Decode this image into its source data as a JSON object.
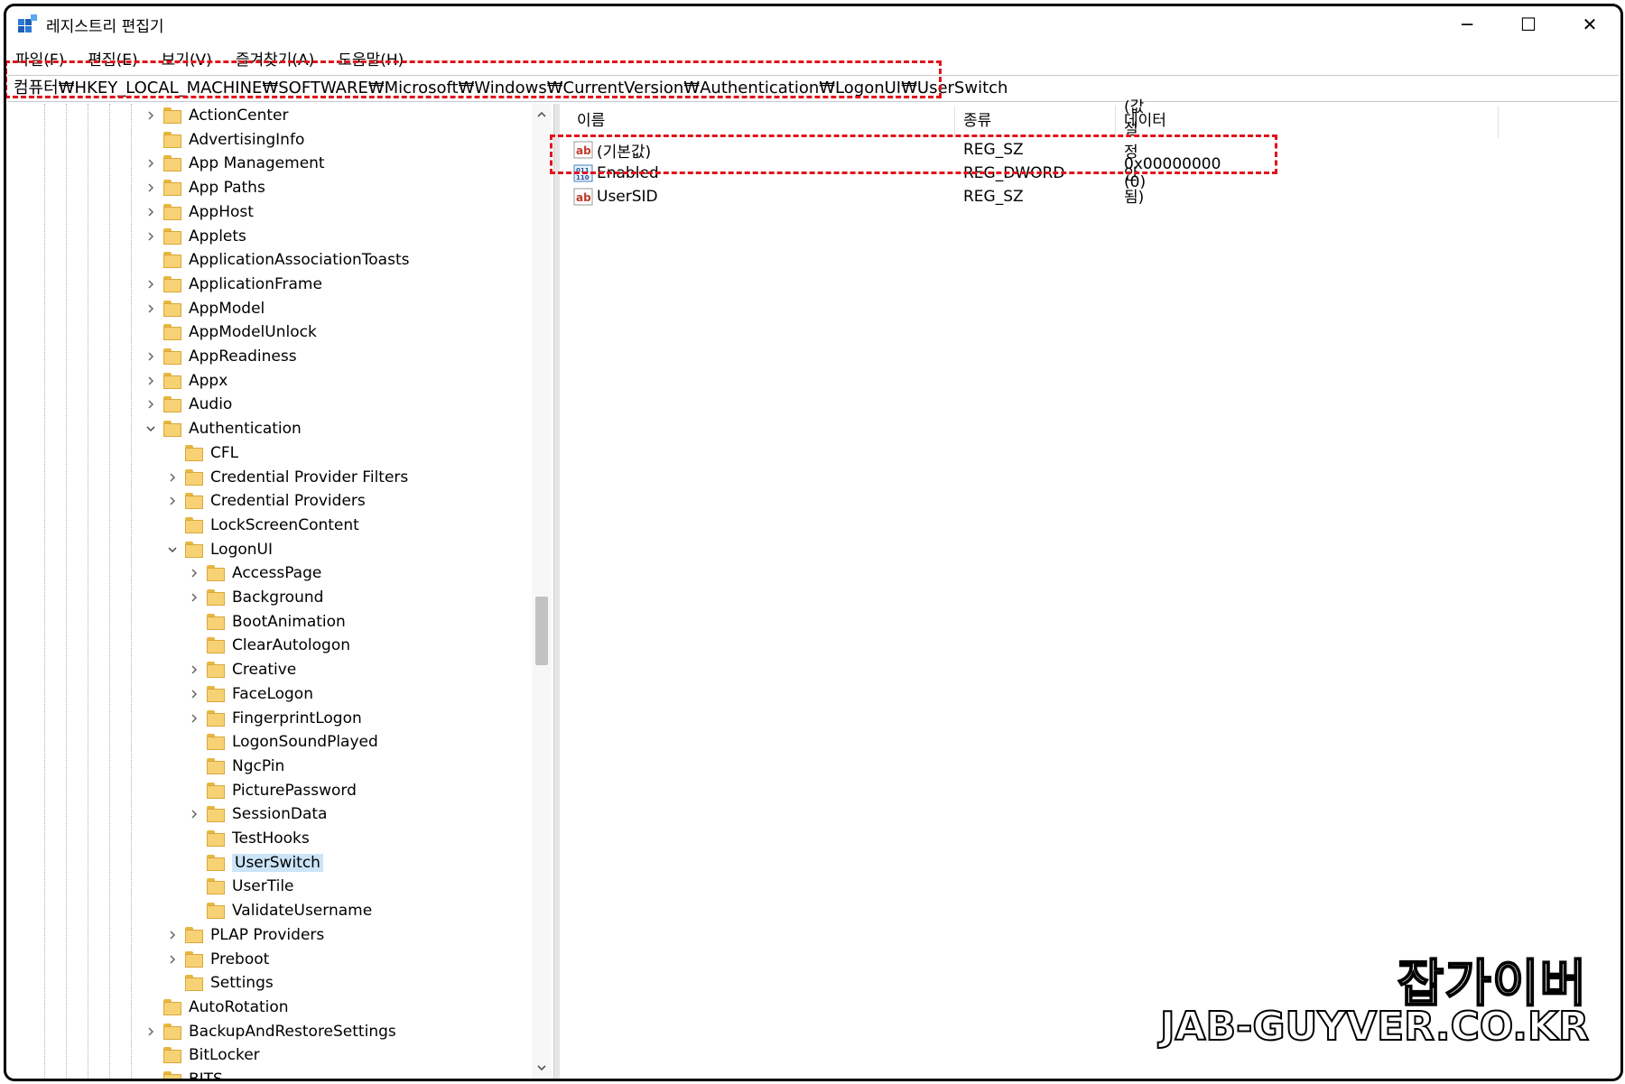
{
  "window": {
    "title": "레지스트리 편집기",
    "controls": [
      "─",
      "☐",
      "✕"
    ]
  },
  "menu": [
    "파일(F)",
    "편집(E)",
    "보기(V)",
    "즐겨찾기(A)",
    "도움말(H)"
  ],
  "address": "컴퓨터₩HKEY_LOCAL_MACHINE₩SOFTWARE₩Microsoft₩Windows₩CurrentVersion₩Authentication₩LogonUI₩UserSwitch",
  "tree": [
    {
      "label": "ActionCenter",
      "level": 0,
      "exp": "collapsed"
    },
    {
      "label": "AdvertisingInfo",
      "level": 0,
      "exp": "none"
    },
    {
      "label": "App Management",
      "level": 0,
      "exp": "collapsed"
    },
    {
      "label": "App Paths",
      "level": 0,
      "exp": "collapsed"
    },
    {
      "label": "AppHost",
      "level": 0,
      "exp": "collapsed"
    },
    {
      "label": "Applets",
      "level": 0,
      "exp": "collapsed"
    },
    {
      "label": "ApplicationAssociationToasts",
      "level": 0,
      "exp": "none"
    },
    {
      "label": "ApplicationFrame",
      "level": 0,
      "exp": "collapsed"
    },
    {
      "label": "AppModel",
      "level": 0,
      "exp": "collapsed"
    },
    {
      "label": "AppModelUnlock",
      "level": 0,
      "exp": "none"
    },
    {
      "label": "AppReadiness",
      "level": 0,
      "exp": "collapsed"
    },
    {
      "label": "Appx",
      "level": 0,
      "exp": "collapsed"
    },
    {
      "label": "Audio",
      "level": 0,
      "exp": "collapsed"
    },
    {
      "label": "Authentication",
      "level": 0,
      "exp": "expanded"
    },
    {
      "label": "CFL",
      "level": 1,
      "exp": "none"
    },
    {
      "label": "Credential Provider Filters",
      "level": 1,
      "exp": "collapsed"
    },
    {
      "label": "Credential Providers",
      "level": 1,
      "exp": "collapsed"
    },
    {
      "label": "LockScreenContent",
      "level": 1,
      "exp": "none"
    },
    {
      "label": "LogonUI",
      "level": 1,
      "exp": "expanded"
    },
    {
      "label": "AccessPage",
      "level": 2,
      "exp": "collapsed"
    },
    {
      "label": "Background",
      "level": 2,
      "exp": "collapsed"
    },
    {
      "label": "BootAnimation",
      "level": 2,
      "exp": "none"
    },
    {
      "label": "ClearAutologon",
      "level": 2,
      "exp": "none"
    },
    {
      "label": "Creative",
      "level": 2,
      "exp": "collapsed"
    },
    {
      "label": "FaceLogon",
      "level": 2,
      "exp": "collapsed"
    },
    {
      "label": "FingerprintLogon",
      "level": 2,
      "exp": "collapsed"
    },
    {
      "label": "LogonSoundPlayed",
      "level": 2,
      "exp": "none"
    },
    {
      "label": "NgcPin",
      "level": 2,
      "exp": "none"
    },
    {
      "label": "PicturePassword",
      "level": 2,
      "exp": "none"
    },
    {
      "label": "SessionData",
      "level": 2,
      "exp": "collapsed"
    },
    {
      "label": "TestHooks",
      "level": 2,
      "exp": "none"
    },
    {
      "label": "UserSwitch",
      "level": 2,
      "exp": "none",
      "selected": true
    },
    {
      "label": "UserTile",
      "level": 2,
      "exp": "none"
    },
    {
      "label": "ValidateUsername",
      "level": 2,
      "exp": "none"
    },
    {
      "label": "PLAP Providers",
      "level": 1,
      "exp": "collapsed"
    },
    {
      "label": "Preboot",
      "level": 1,
      "exp": "collapsed"
    },
    {
      "label": "Settings",
      "level": 1,
      "exp": "none"
    },
    {
      "label": "AutoRotation",
      "level": 0,
      "exp": "none"
    },
    {
      "label": "BackupAndRestoreSettings",
      "level": 0,
      "exp": "collapsed"
    },
    {
      "label": "BitLocker",
      "level": 0,
      "exp": "none"
    },
    {
      "label": "BITS",
      "level": 0,
      "exp": "none"
    }
  ],
  "list": {
    "headers": [
      "이름",
      "종류",
      "데이터"
    ],
    "rows": [
      {
        "name": "(기본값)",
        "type": "REG_SZ",
        "data": "(값 설정 안 됨)",
        "icon": "string-value-icon"
      },
      {
        "name": "Enabled",
        "type": "REG_DWORD",
        "data": "0x00000000 (0)",
        "icon": "dword-value-icon"
      },
      {
        "name": "UserSID",
        "type": "REG_SZ",
        "data": "",
        "icon": "string-value-icon"
      }
    ]
  },
  "watermark": {
    "line1": "잡가이버",
    "line2": "JAB-GUYVER.CO.KR"
  },
  "colors": {
    "highlight": "#e0141a",
    "selection": "#cce4f7",
    "folder": "#f7d274"
  }
}
